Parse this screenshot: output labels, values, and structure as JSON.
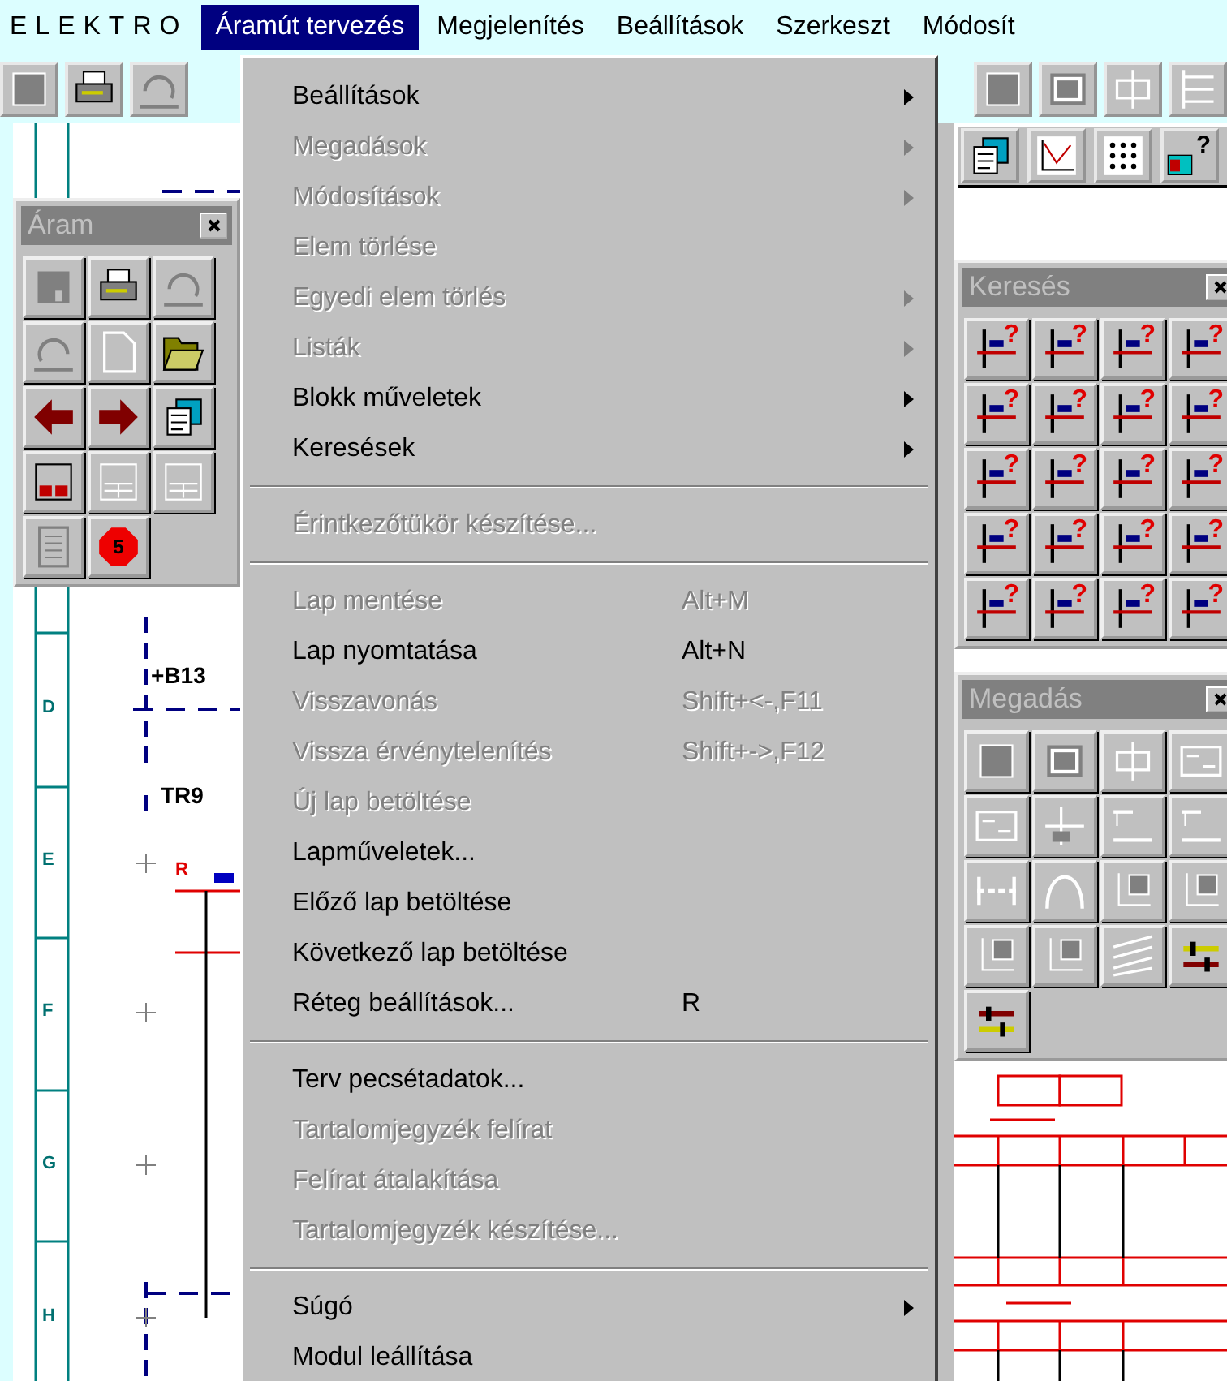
{
  "menu_bar": {
    "items": [
      {
        "label": "ELEKTRO",
        "kind": "brand",
        "selected": false
      },
      {
        "label": "Áramút tervezés",
        "kind": "menu",
        "selected": true
      },
      {
        "label": "Megjelenítés",
        "kind": "menu",
        "selected": false
      },
      {
        "label": "Beállítások",
        "kind": "menu",
        "selected": false
      },
      {
        "label": "Szerkeszt",
        "kind": "menu",
        "selected": false
      },
      {
        "label": "Módosít",
        "kind": "menu",
        "selected": false
      }
    ]
  },
  "toolbar": {
    "help_mark": "?"
  },
  "menu": {
    "sections": [
      [
        {
          "label": "Beállítások",
          "submenu": true,
          "disabled": false
        },
        {
          "label": "Megadások",
          "submenu": true,
          "disabled": true
        },
        {
          "label": "Módosítások",
          "submenu": true,
          "disabled": true
        },
        {
          "label": "Elem törlése",
          "submenu": false,
          "disabled": true
        },
        {
          "label": "Egyedi elem törlés",
          "submenu": true,
          "disabled": true
        },
        {
          "label": "Listák",
          "submenu": true,
          "disabled": true
        },
        {
          "label": "Blokk műveletek",
          "submenu": true,
          "disabled": false
        },
        {
          "label": "Keresések",
          "submenu": true,
          "disabled": false
        }
      ],
      [
        {
          "label": "Érintkezőtükör készítése...",
          "submenu": false,
          "disabled": true
        }
      ],
      [
        {
          "label": "Lap mentése",
          "shortcut": "Alt+M",
          "submenu": false,
          "disabled": true
        },
        {
          "label": "Lap nyomtatása",
          "shortcut": "Alt+N",
          "submenu": false,
          "disabled": false
        },
        {
          "label": "Visszavonás",
          "shortcut": "Shift+<-,F11",
          "submenu": false,
          "disabled": true
        },
        {
          "label": "Vissza érvénytelenítés",
          "shortcut": "Shift+->,F12",
          "submenu": false,
          "disabled": true
        },
        {
          "label": "Új lap betöltése",
          "submenu": false,
          "disabled": true
        },
        {
          "label": "Lapműveletek...",
          "submenu": false,
          "disabled": false
        },
        {
          "label": "Előző lap betöltése",
          "submenu": false,
          "disabled": false
        },
        {
          "label": "Következő lap betöltése",
          "submenu": false,
          "disabled": false
        },
        {
          "label": "Réteg beállítások...",
          "shortcut": "R",
          "submenu": false,
          "disabled": false
        }
      ],
      [
        {
          "label": "Terv pecsétadatok...",
          "submenu": false,
          "disabled": false
        },
        {
          "label": "Tartalomjegyzék felírat",
          "submenu": false,
          "disabled": true
        },
        {
          "label": "Felírat átalakítása",
          "submenu": false,
          "disabled": true
        },
        {
          "label": "Tartalomjegyzék készítése...",
          "submenu": false,
          "disabled": true
        }
      ],
      [
        {
          "label": "Súgó",
          "submenu": true,
          "disabled": false
        },
        {
          "label": "Modul leállítása",
          "submenu": false,
          "disabled": false
        }
      ]
    ]
  },
  "palettes": [
    {
      "title": "Áram",
      "kind": "aram",
      "stop_number": "5"
    },
    {
      "title": "Keresés",
      "kind": "search",
      "marks": [
        "?",
        "?",
        "?",
        "?",
        "?",
        "?",
        "?",
        "?",
        "?",
        "?",
        "?",
        "?",
        "?",
        "?",
        "?",
        "?",
        "?",
        "?",
        "?",
        "?"
      ]
    },
    {
      "title": "Megadás",
      "kind": "input"
    }
  ],
  "sheet": {
    "row_labels": [
      "D",
      "E",
      "F",
      "G",
      "H"
    ],
    "labels": [
      {
        "text": "+B13",
        "kind": "tag"
      },
      {
        "text": "TR9",
        "kind": "tag"
      },
      {
        "text": "R",
        "kind": "pin"
      }
    ]
  }
}
